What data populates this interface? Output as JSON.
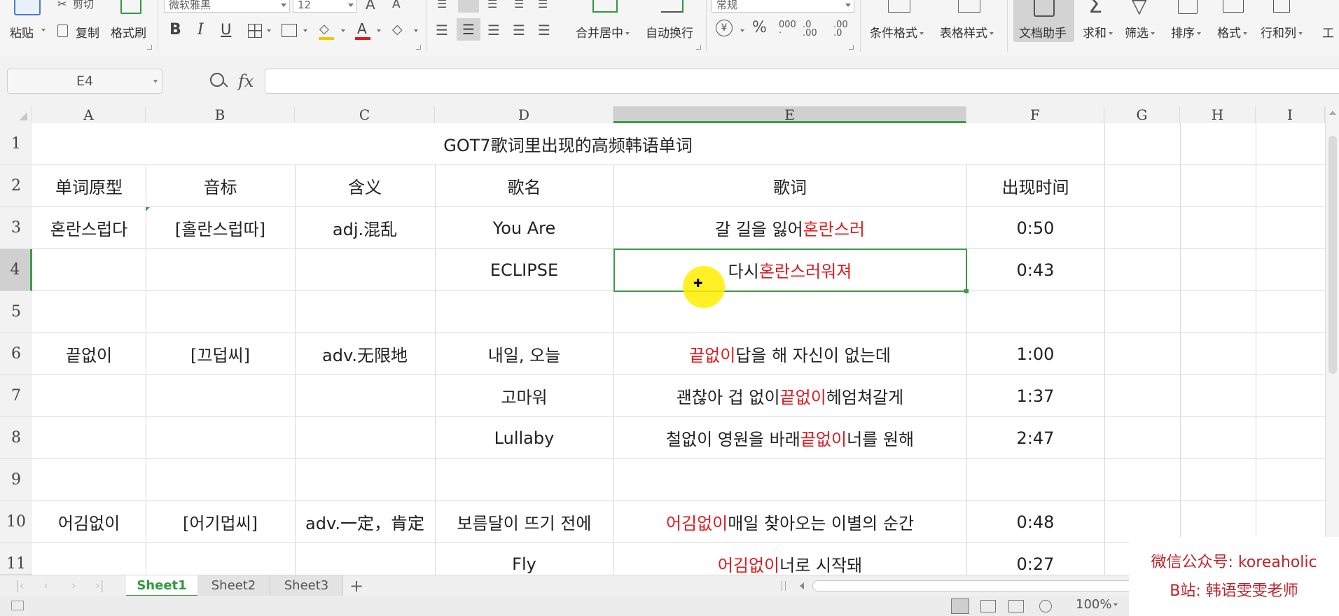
{
  "ribbon": {
    "clipboard": {
      "cut": "剪切",
      "paste": "粘贴",
      "copy": "复制",
      "format_painter": "格式刷"
    },
    "font": {
      "name": "微软雅黑",
      "size": "12"
    },
    "alignment": {
      "merge": "合并居中",
      "wrap": "自动换行"
    },
    "number": {
      "format": "常规"
    },
    "styles": {
      "conditional": "条件格式",
      "table_style": "表格样式"
    },
    "tools": {
      "doc_helper": "文档助手",
      "sum": "求和",
      "filter": "筛选",
      "sort": "排序",
      "format": "格式",
      "row_col": "行和列",
      "more": "工"
    }
  },
  "formula_bar": {
    "name_box": "E4",
    "fx": "fx",
    "value": ""
  },
  "columns": [
    "A",
    "B",
    "C",
    "D",
    "E",
    "F",
    "G",
    "H",
    "I"
  ],
  "rows": [
    "1",
    "2",
    "3",
    "4",
    "5",
    "6",
    "7",
    "8",
    "9",
    "10",
    "11"
  ],
  "sheet": {
    "title": "GOT7歌词里出现的高频韩语单词",
    "headers": [
      "单词原型",
      "音标",
      "含义",
      "歌名",
      "歌词",
      "出现时间"
    ],
    "data": [
      {
        "word": "혼란스럽다",
        "pron": "[홀란스럽따]",
        "meaning": "adj.混乱",
        "song": "You Are",
        "lyric_pre": "갈 길을 잃어 ",
        "lyric_hl": "혼란스러",
        "lyric_post": "",
        "time": "0:50"
      },
      {
        "word": "",
        "pron": "",
        "meaning": "",
        "song": "ECLIPSE",
        "lyric_pre": "다시 ",
        "lyric_hl": "혼란스러워져",
        "lyric_post": "",
        "time": "0:43"
      },
      {
        "word": "",
        "pron": "",
        "meaning": "",
        "song": "",
        "lyric_pre": "",
        "lyric_hl": "",
        "lyric_post": "",
        "time": ""
      },
      {
        "word": "끝없이",
        "pron": "[끄덥씨]",
        "meaning": "adv.无限地",
        "song": "내일, 오늘",
        "lyric_pre": "",
        "lyric_hl": "끝없이",
        "lyric_post": " 답을 해 자신이 없는데",
        "time": "1:00"
      },
      {
        "word": "",
        "pron": "",
        "meaning": "",
        "song": "고마워",
        "lyric_pre": "괜찮아 겁 없이 ",
        "lyric_hl": "끝없이",
        "lyric_post": " 헤엄쳐갈게",
        "time": "1:37"
      },
      {
        "word": "",
        "pron": "",
        "meaning": "",
        "song": "Lullaby",
        "lyric_pre": "철없이 영원을 바래 ",
        "lyric_hl": "끝없이",
        "lyric_post": " 너를 원해",
        "time": "2:47"
      },
      {
        "word": "",
        "pron": "",
        "meaning": "",
        "song": "",
        "lyric_pre": "",
        "lyric_hl": "",
        "lyric_post": "",
        "time": ""
      },
      {
        "word": "어김없이",
        "pron": "[어기멉씨]",
        "meaning": "adv.一定，肯定",
        "song": "보름달이 뜨기 전에",
        "lyric_pre": "",
        "lyric_hl": "어김없이",
        "lyric_post": " 매일 찾아오는 이별의 순간",
        "time": "0:48"
      },
      {
        "word": "",
        "pron": "",
        "meaning": "",
        "song": "Fly",
        "lyric_pre": "",
        "lyric_hl": "어김없이",
        "lyric_post": " 너로 시작돼",
        "time": "0:27"
      }
    ]
  },
  "tabs": [
    "Sheet1",
    "Sheet2",
    "Sheet3"
  ],
  "add_sheet": "+",
  "status": {
    "zoom": "100%"
  },
  "watermark": {
    "line1": "微信公众号: koreaholic",
    "line2": "B站: 韩语雯雯老师"
  },
  "colors": {
    "accent": "#3d9b48",
    "highlight": "#e0191e",
    "cursor": "#ffee00"
  }
}
